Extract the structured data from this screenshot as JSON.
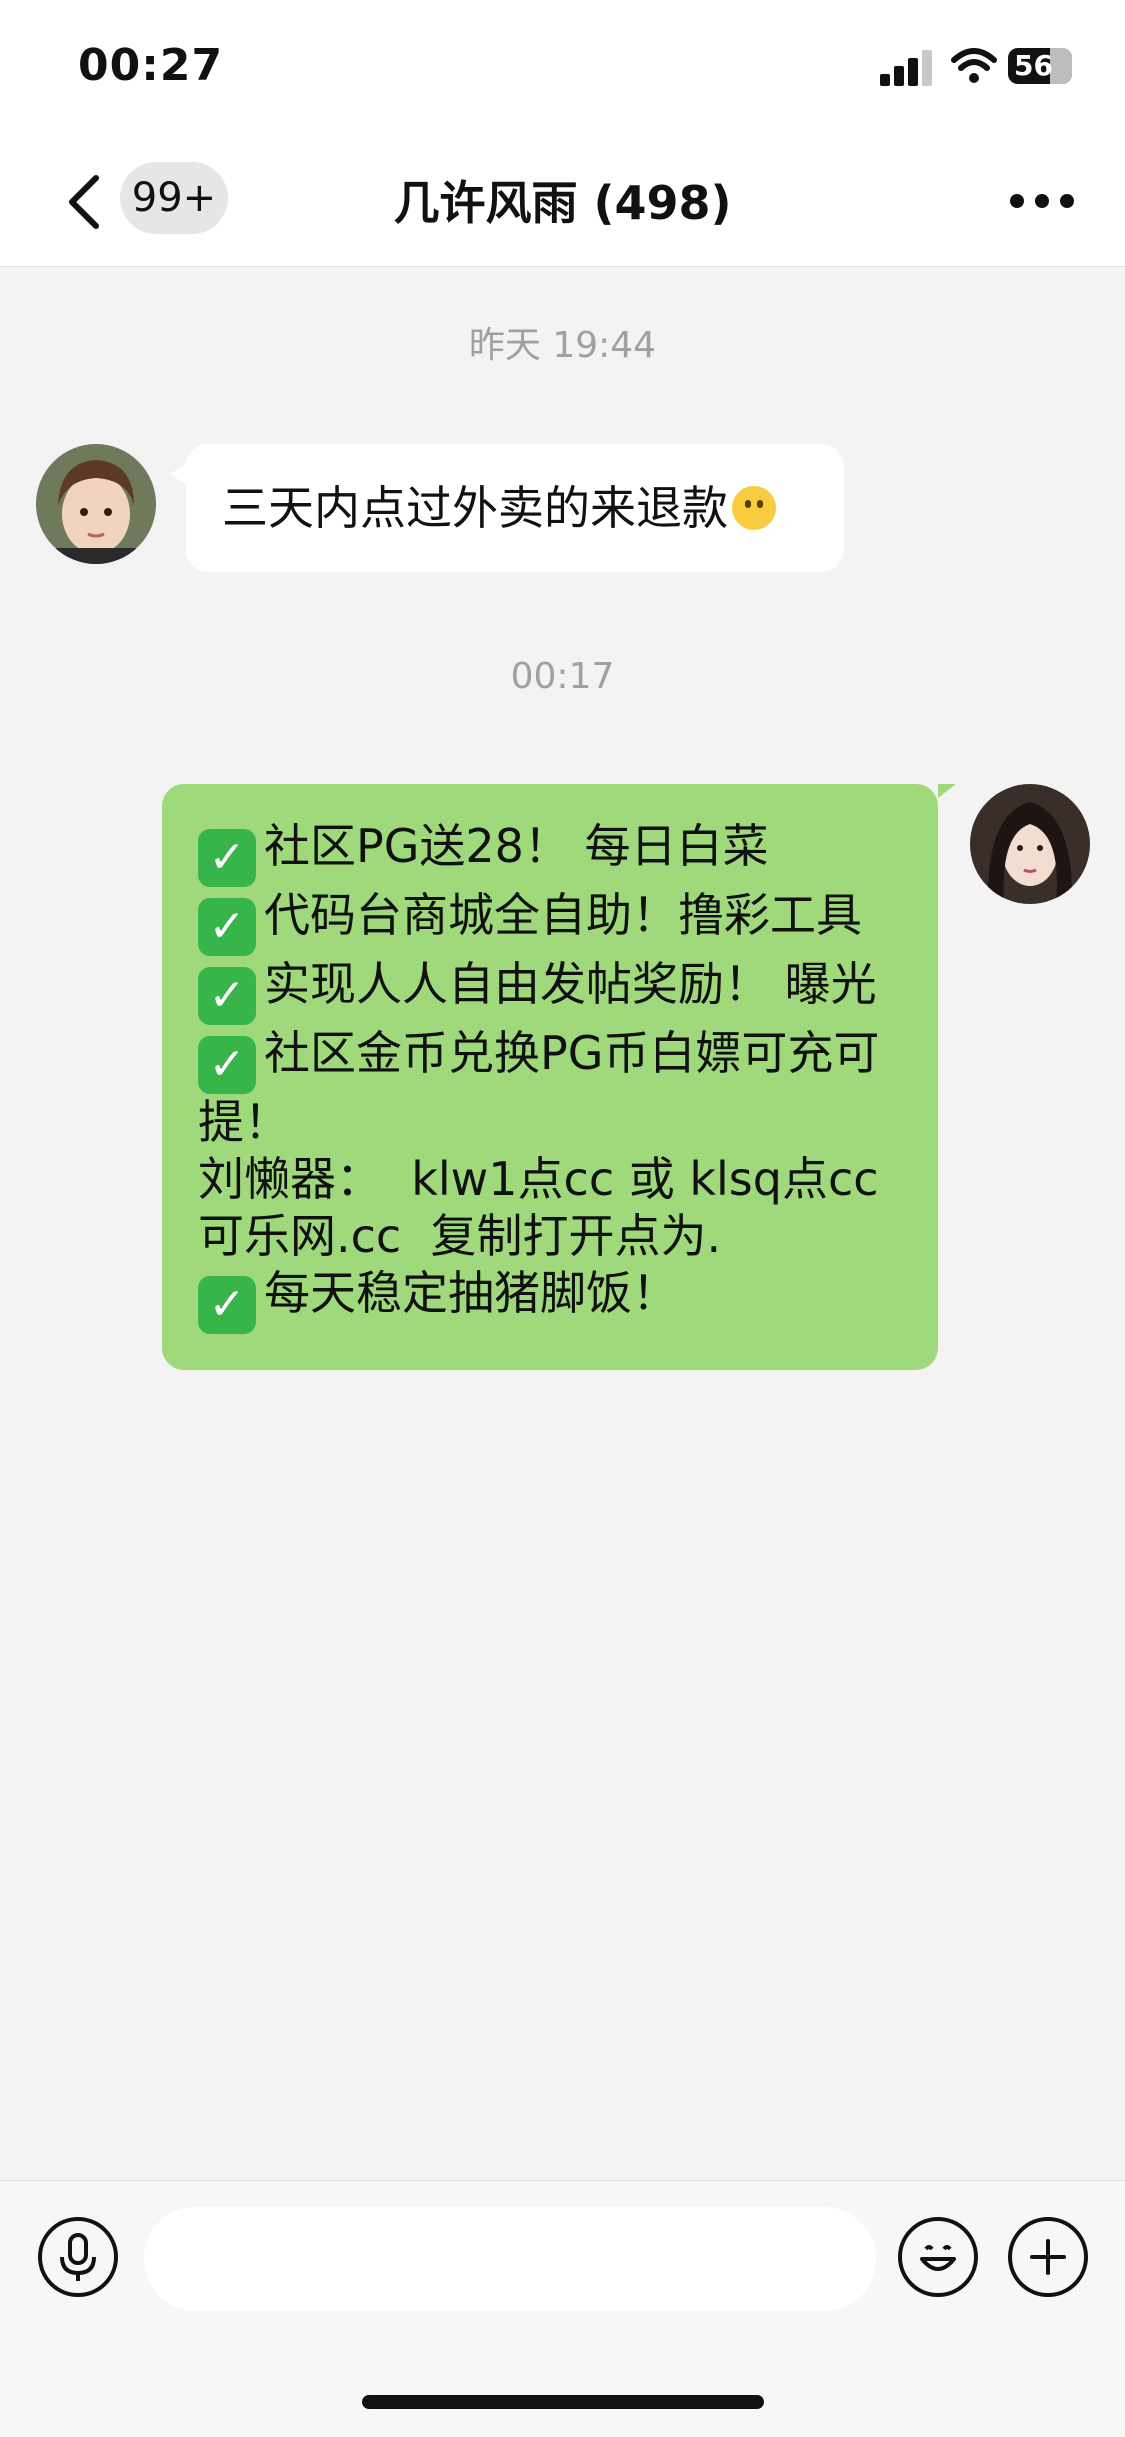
{
  "status_bar": {
    "time": "00:27",
    "battery": "56"
  },
  "nav": {
    "unread_badge": "99+",
    "title": "几许风雨 (498)"
  },
  "chat": {
    "timestamps": [
      "昨天 19:44",
      "00:17"
    ],
    "incoming_message": {
      "text": "三天内点过外卖的来退款",
      "emoji": "slight-smile-emoji"
    },
    "outgoing_message": {
      "lines": [
        {
          "check": true,
          "text": "社区PG送28！ 每日白菜"
        },
        {
          "check": true,
          "text": "代码台商城全自助！撸彩工具"
        },
        {
          "check": true,
          "text": "实现人人自由发帖奖励！ 曝光"
        },
        {
          "check": true,
          "text": "社区金币兑换PG币白嫖可充可提！"
        },
        {
          "check": false,
          "text": "刘懒器：  klw1点cc 或 klsq点cc 可乐网.cc  复制打开点为."
        },
        {
          "check": true,
          "text": "每天稳定抽猪脚饭！"
        }
      ]
    }
  },
  "colors": {
    "outgoing_bubble": "#a0d97c",
    "incoming_bubble": "#ffffff",
    "background": "#f3f3f3",
    "check_mark": "#37b44a"
  },
  "icons": {
    "back": "chevron-left-icon",
    "more": "more-dots-icon",
    "voice": "microphone-icon",
    "emoji": "emoji-icon",
    "add": "plus-icon"
  }
}
